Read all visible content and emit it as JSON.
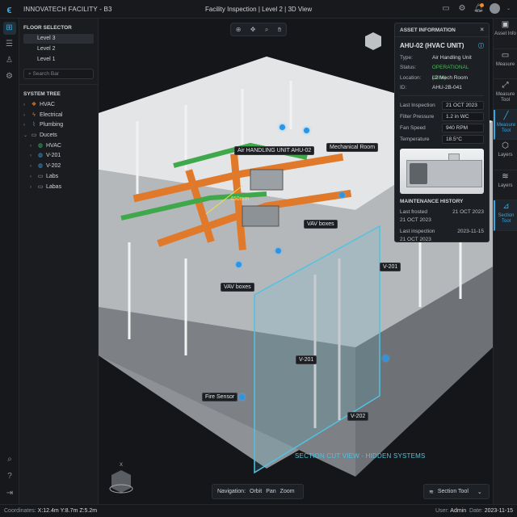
{
  "header": {
    "title": "INNOVATECH FACILITY - B3",
    "breadcrumb": [
      "Facility Inspection",
      "Level 2",
      "3D View"
    ],
    "icons": [
      "monitor-icon",
      "gear-icon",
      "bell-icon",
      "avatar"
    ]
  },
  "floor_selector": {
    "heading": "FLOOR SELECTOR",
    "levels": [
      "Level 3",
      "Level 2",
      "Level 1"
    ],
    "selected": "Level 3",
    "search_placeholder": "Search Bar"
  },
  "system_tree": {
    "heading": "SYSTEM TREE",
    "items": [
      {
        "label": "HVAC",
        "icon": "hvac-icon",
        "color": "#e07a2a",
        "expanded": false
      },
      {
        "label": "Electrical",
        "icon": "bolt-icon",
        "color": "#e07a2a",
        "expanded": false
      },
      {
        "label": "Plumbing",
        "icon": "pipe-icon",
        "color": "#5aa6c8",
        "expanded": false
      },
      {
        "label": "Ducets",
        "icon": "folder-icon",
        "color": "#a0a6ad",
        "expanded": true,
        "children": [
          {
            "label": "HVAC",
            "icon": "globe-icon",
            "color": "#3fbf6a"
          },
          {
            "label": "V-201",
            "icon": "globe-icon",
            "color": "#3aa6e0"
          },
          {
            "label": "V-202",
            "icon": "globe-icon",
            "color": "#3aa6e0"
          },
          {
            "label": "Labs",
            "icon": "folder-icon",
            "color": "#a0a6ad"
          },
          {
            "label": "Labas",
            "icon": "folder-icon",
            "color": "#a0a6ad"
          }
        ]
      }
    ]
  },
  "asset": {
    "heading": "ASSET INFORMATION",
    "title": "AHU-02 (HVAC UNIT)",
    "props": [
      {
        "k": "Type:",
        "v": "Air Handling Unit"
      },
      {
        "k": "Status:",
        "v": "OPERATIONAL (98%)"
      },
      {
        "k": "Location:",
        "v": "L2 Mech Room"
      },
      {
        "k": "ID:",
        "v": "AHU-2B-041"
      }
    ],
    "fields": [
      {
        "k": "Last Inspection",
        "v": "21 OCT 2023"
      },
      {
        "k": "Filter Pressure",
        "v": "1.2 in WC"
      },
      {
        "k": "Fan Speed",
        "v": "940 RPM"
      },
      {
        "k": "Temperature",
        "v": "18.5°C"
      }
    ],
    "maintenance_heading": "MAINTENANCE HISTORY",
    "maintenance": [
      {
        "label": "Last frosted",
        "date": "21 OCT 2023",
        "sub": "21 OCT 2023"
      },
      {
        "label": "Last inspection",
        "date": "2023-11-15",
        "sub": "21 OCT 2023"
      }
    ]
  },
  "right_tools": [
    {
      "label": "Asset Info",
      "g": "▣"
    },
    {
      "label": "Measure",
      "g": "▭"
    },
    {
      "label": "Measure Tool",
      "g": "⤢"
    },
    {
      "label": "Measure Tool",
      "g": "╱",
      "active": true
    },
    {
      "label": "Layers",
      "g": "⬡"
    },
    {
      "label": "Layers",
      "g": "≋"
    },
    {
      "label": "Section Tool",
      "g": "⊿",
      "active": true
    }
  ],
  "scene_labels": {
    "ahu": "Air HANDLING UNIT AHU-02",
    "mech": "Mechanical Room",
    "dim": "450mm",
    "vav1": "VAV boxes",
    "vav2": "VAV boxes",
    "v201a": "V-201",
    "v201b": "V-201",
    "v202": "V-202",
    "fire": "Fire Sensor",
    "section": "SECTION CUT VIEW - HIDDEN SYSTEMS",
    "axis": "X"
  },
  "navigation": {
    "label": "Navigation:",
    "modes": [
      "Orbit",
      "Pan",
      "Zoom"
    ]
  },
  "section_tool": {
    "label": "Section Tool"
  },
  "status": {
    "coords_label": "Coordinates:",
    "x": "X:12.4m",
    "y": "Y:8.7m",
    "z": "Z:5.2m",
    "user_label": "User:",
    "user": "Admin",
    "date_label": "Date:",
    "date": "2023-11-15"
  }
}
